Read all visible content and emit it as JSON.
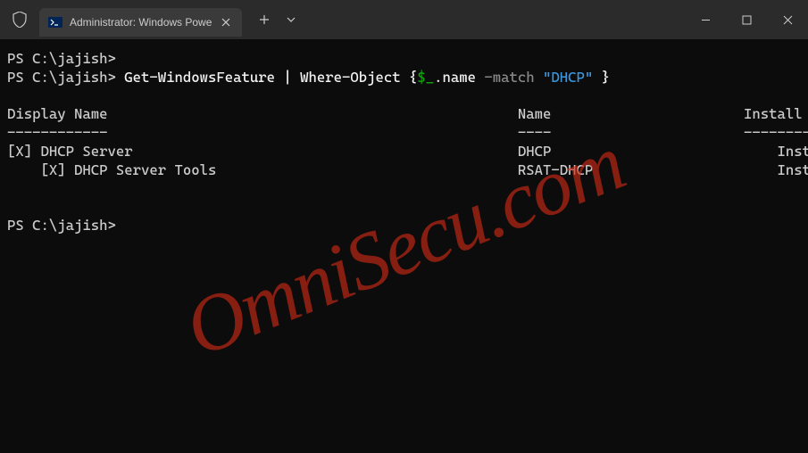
{
  "titlebar": {
    "tab_title": "Administrator: Windows Powe"
  },
  "terminal": {
    "prompt1": "PS C:\\jajish>",
    "prompt2": "PS C:\\jajish> ",
    "cmd_part1": "Get-WindowsFeature ",
    "cmd_pipe": "| ",
    "cmd_part2": "Where-Object ",
    "cmd_brace_open": "{",
    "cmd_var": "$_",
    "cmd_prop": ".name ",
    "cmd_op": "-match ",
    "cmd_string": "\"DHCP\" ",
    "cmd_brace_close": "}",
    "header_display": "Display Name",
    "header_name": "Name",
    "header_state": "Install State",
    "dash_display": "------------",
    "dash_name": "----",
    "dash_state": "-------------",
    "row1_display": "[X] DHCP Server",
    "row1_name": "DHCP",
    "row1_state": "Installed",
    "row2_display": "    [X] DHCP Server Tools",
    "row2_name": "RSAT-DHCP",
    "row2_state": "Installed",
    "prompt3": "PS C:\\jajish>"
  },
  "watermark": "OmniSecu.com"
}
